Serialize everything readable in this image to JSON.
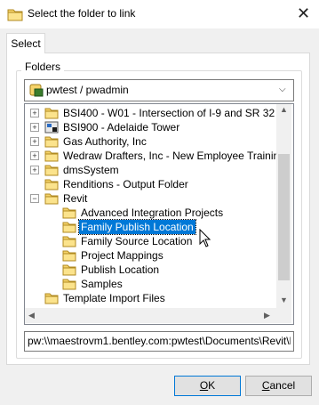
{
  "window": {
    "title": "Select the folder to link",
    "close_glyph": "✕"
  },
  "tabs": [
    {
      "label": "Select"
    }
  ],
  "folders_group": {
    "label": "Folders",
    "datasource": {
      "value": "pwtest / pwadmin",
      "icon": "datasource-icon"
    }
  },
  "tree": {
    "items": [
      {
        "label": "BSI400 - W01 - Intersection of I-9 and SR 32",
        "icon": "folder-icon",
        "expander": "+"
      },
      {
        "label": "BSI900 - Adelaide Tower",
        "icon": "project-icon",
        "expander": "+"
      },
      {
        "label": "Gas Authority, Inc",
        "icon": "folder-icon",
        "expander": "+"
      },
      {
        "label": "Wedraw Drafters, Inc - New Employee Trainin",
        "icon": "folder-icon",
        "expander": "+"
      },
      {
        "label": "dmsSystem",
        "icon": "folder-icon",
        "expander": "+"
      },
      {
        "label": "Renditions - Output Folder",
        "icon": "folder-icon",
        "expander": ""
      },
      {
        "label": "Revit",
        "icon": "folder-icon",
        "expander": "−"
      },
      {
        "label": "Advanced Integration Projects",
        "icon": "folder-icon",
        "expander": ""
      },
      {
        "label": "Family Publish Location",
        "icon": "folder-icon",
        "expander": "",
        "selected": true
      },
      {
        "label": "Family Source Location",
        "icon": "folder-icon",
        "expander": ""
      },
      {
        "label": "Project Mappings",
        "icon": "folder-icon",
        "expander": ""
      },
      {
        "label": "Publish Location",
        "icon": "folder-icon",
        "expander": ""
      },
      {
        "label": "Samples",
        "icon": "folder-icon",
        "expander": ""
      },
      {
        "label": "Template Import Files",
        "icon": "folder-icon",
        "expander": ""
      }
    ]
  },
  "path": {
    "value": "pw:\\\\maestrovm1.bentley.com:pwtest\\Documents\\Revit\\F"
  },
  "buttons": {
    "ok": "OK",
    "cancel": "Cancel"
  },
  "colors": {
    "selection": "#0078d7",
    "folder": "#f5d36a"
  }
}
